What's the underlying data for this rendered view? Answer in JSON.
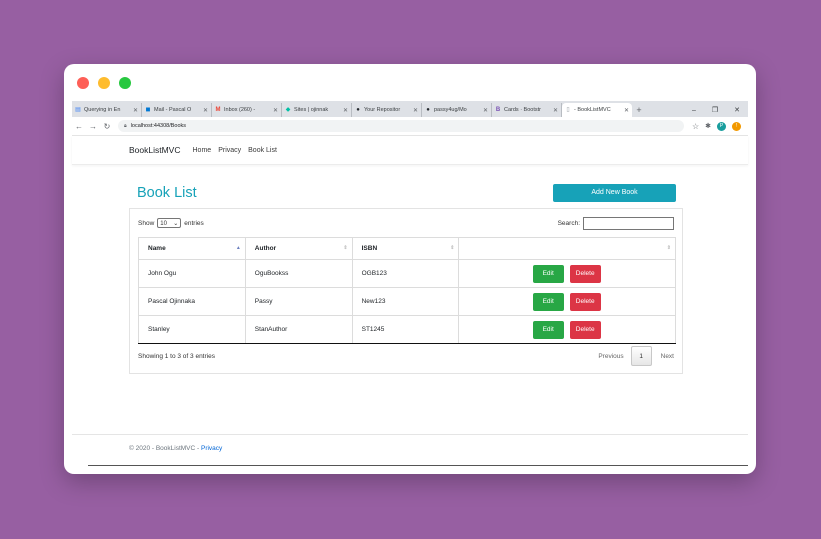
{
  "browser": {
    "tabs": [
      {
        "label": "Querying in En",
        "icon": "doc-icon",
        "color": "#4285f4"
      },
      {
        "label": "Mail - Pascal O",
        "icon": "outlook-icon",
        "color": "#0078d4"
      },
      {
        "label": "Inbox (260) - ",
        "icon": "gmail-icon",
        "color": "#ea4335"
      },
      {
        "label": "Sites | ojinnak",
        "icon": "diamond-icon",
        "color": "#00bfa5"
      },
      {
        "label": "Your Repositor",
        "icon": "github-icon",
        "color": "#24292e"
      },
      {
        "label": "passy4ug/Mo",
        "icon": "github-icon",
        "color": "#24292e"
      },
      {
        "label": "Cards · Bootstr",
        "icon": "bootstrap-icon",
        "color": "#7952b3"
      },
      {
        "label": "- BookListMVC",
        "icon": "page-icon",
        "color": "#9aa0a6"
      }
    ],
    "new_tab": "+",
    "controls": {
      "minimize": "–",
      "restore": "❐",
      "close": "✕"
    },
    "url": "localhost:44308/Books",
    "avatars": [
      {
        "label": "P",
        "color": "#1a9e9e"
      },
      {
        "label": "!",
        "color": "#f29900"
      }
    ]
  },
  "navbar": {
    "brand": "BookListMVC",
    "links": [
      "Home",
      "Privacy",
      "Book List"
    ]
  },
  "main": {
    "title": "Book List",
    "add_button": "Add New Book",
    "show_label": "Show",
    "page_length": "10",
    "entries_label": "entries",
    "search_label": "Search:",
    "search_value": "",
    "columns": [
      "Name",
      "Author",
      "ISBN",
      ""
    ],
    "rows": [
      {
        "name": "John Ogu",
        "author": "OguBookss",
        "isbn": "OGB123"
      },
      {
        "name": "Pascal Ojinnaka",
        "author": "Passy",
        "isbn": "New123"
      },
      {
        "name": "Stanley",
        "author": "StanAuthor",
        "isbn": "ST1245"
      }
    ],
    "edit_label": "Edit",
    "delete_label": "Delete",
    "info": "Showing 1 to 3 of 3 entries",
    "pager": {
      "previous": "Previous",
      "current": "1",
      "next": "Next"
    }
  },
  "footer": {
    "text": "© 2020 - BookListMVC - ",
    "link": "Privacy"
  }
}
